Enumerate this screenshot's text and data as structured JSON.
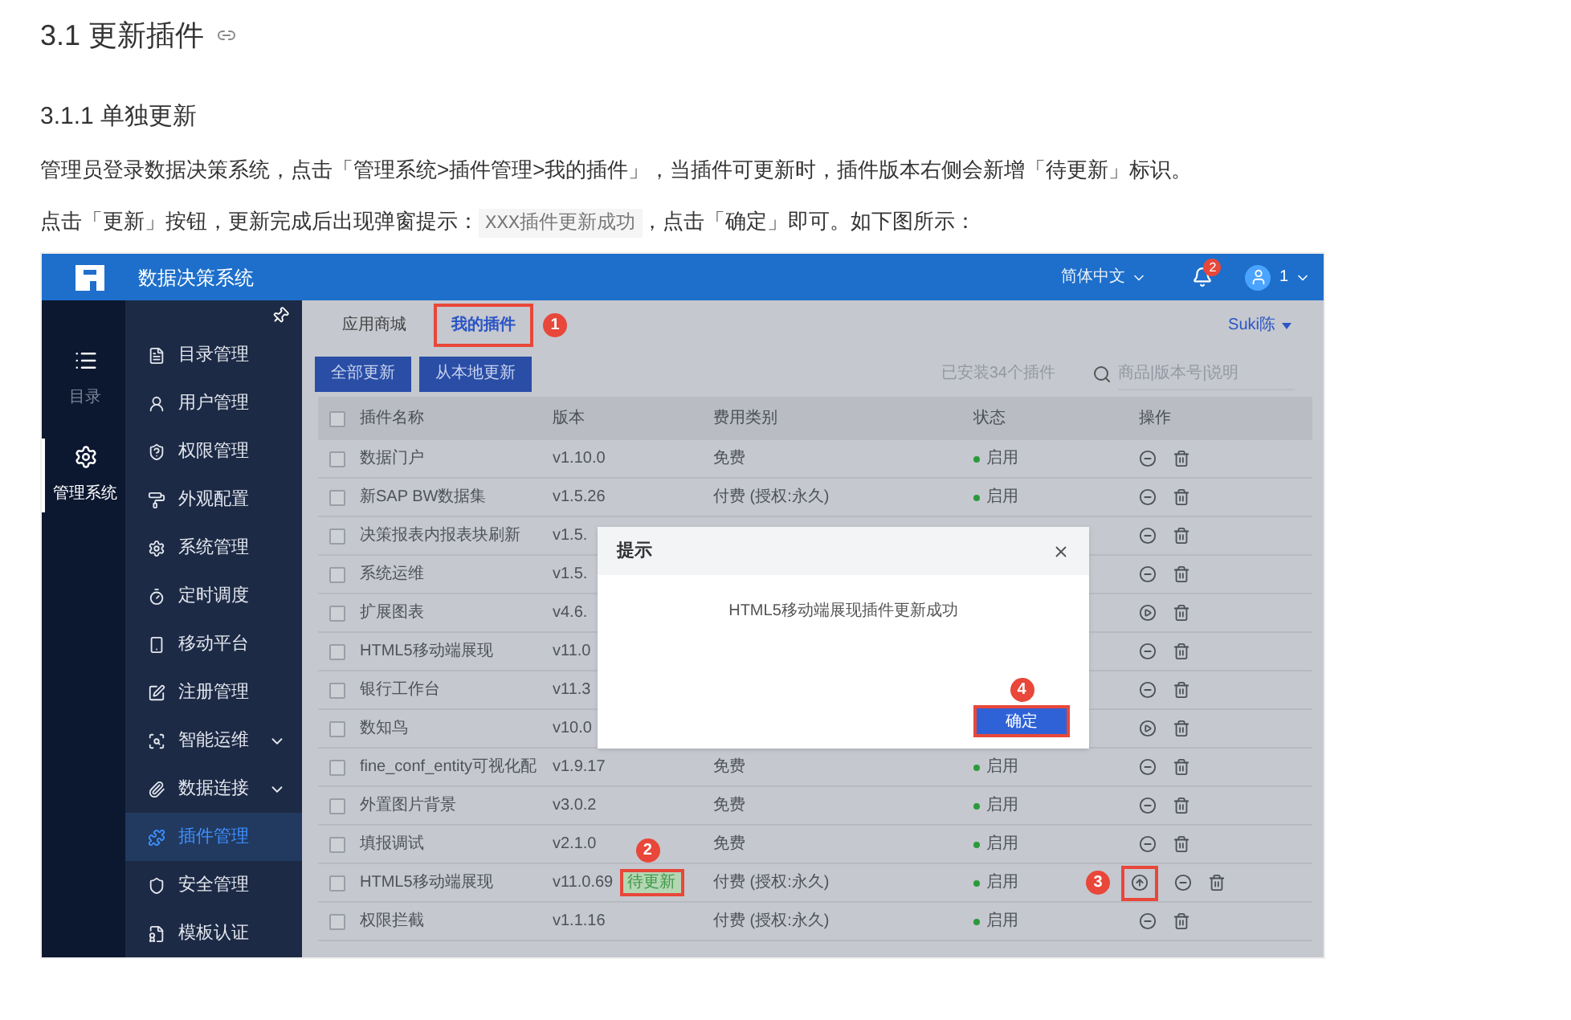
{
  "heading": "3.1 更新插件",
  "subheading": "3.1.1 单独更新",
  "paragraph_1": "管理员登录数据决策系统，点击「管理系统>插件管理>我的插件」，当插件可更新时，插件版本右侧会新增「待更新」标识。",
  "paragraph_2": {
    "before": "点击「更新」按钮，更新完成后出现弹窗提示：",
    "code": "XXX插件更新成功",
    "after": "，点击「确定」即可。如下图所示："
  },
  "app": {
    "title": "数据决策系统",
    "language": "简体中文",
    "notification_count": "2",
    "user": "1",
    "rail": [
      {
        "label": "目录",
        "selected": false
      },
      {
        "label": "管理系统",
        "selected": true
      }
    ],
    "menu": [
      {
        "label": "目录管理",
        "selected": false,
        "has_submenu": false
      },
      {
        "label": "用户管理",
        "selected": false,
        "has_submenu": false
      },
      {
        "label": "权限管理",
        "selected": false,
        "has_submenu": false
      },
      {
        "label": "外观配置",
        "selected": false,
        "has_submenu": false
      },
      {
        "label": "系统管理",
        "selected": false,
        "has_submenu": false
      },
      {
        "label": "定时调度",
        "selected": false,
        "has_submenu": false
      },
      {
        "label": "移动平台",
        "selected": false,
        "has_submenu": false
      },
      {
        "label": "注册管理",
        "selected": false,
        "has_submenu": false
      },
      {
        "label": "智能运维",
        "selected": false,
        "has_submenu": true
      },
      {
        "label": "数据连接",
        "selected": false,
        "has_submenu": true
      },
      {
        "label": "插件管理",
        "selected": true,
        "has_submenu": false
      },
      {
        "label": "安全管理",
        "selected": false,
        "has_submenu": false
      },
      {
        "label": "模板认证",
        "selected": false,
        "has_submenu": false
      }
    ],
    "tabs": [
      {
        "label": "应用商城",
        "selected": false
      },
      {
        "label": "我的插件",
        "selected": true,
        "callout": "1"
      }
    ],
    "account": "Suki陈",
    "buttons": [
      "全部更新",
      "从本地更新"
    ],
    "installed_count": "已安装34个插件",
    "search": {
      "placeholder": "商品|版本号|说明"
    },
    "select_all_checked": false,
    "columns": [
      "插件名称",
      "版本",
      "费用类别",
      "状态",
      "操作"
    ],
    "rows": [
      {
        "checked": false,
        "name": "数据门户",
        "version": "v1.10.0",
        "cost": "免费",
        "status": "启用",
        "enabled": true,
        "ops": [
          {
            "kind": "disable"
          },
          {
            "kind": "delete"
          }
        ]
      },
      {
        "checked": false,
        "name": "新SAP BW数据集",
        "version": "v1.5.26",
        "cost": "付费 (授权:永久)",
        "status": "启用",
        "enabled": true,
        "ops": [
          {
            "kind": "disable"
          },
          {
            "kind": "delete"
          }
        ]
      },
      {
        "checked": false,
        "name": "决策报表内报表块刷新",
        "version": "v1.5.",
        "ops": [
          {
            "kind": "disable"
          },
          {
            "kind": "delete"
          }
        ]
      },
      {
        "checked": false,
        "name": "系统运维",
        "version": "v1.5.",
        "ops": [
          {
            "kind": "disable"
          },
          {
            "kind": "delete"
          }
        ]
      },
      {
        "checked": false,
        "name": "扩展图表",
        "version": "v4.6.",
        "ops": [
          {
            "kind": "enable"
          },
          {
            "kind": "delete"
          }
        ]
      },
      {
        "checked": false,
        "name": "HTML5移动端展现",
        "version": "v11.0",
        "ops": [
          {
            "kind": "disable"
          },
          {
            "kind": "delete"
          }
        ]
      },
      {
        "checked": false,
        "name": "银行工作台",
        "version": "v11.3",
        "ops": [
          {
            "kind": "disable"
          },
          {
            "kind": "delete"
          }
        ]
      },
      {
        "checked": false,
        "name": "数知鸟",
        "version": "v10.0",
        "ops": [
          {
            "kind": "enable"
          },
          {
            "kind": "delete"
          }
        ]
      },
      {
        "checked": false,
        "name": "fine_conf_entity可视化配",
        "version": "v1.9.17",
        "cost": "免费",
        "status": "启用",
        "enabled": true,
        "ops": [
          {
            "kind": "disable"
          },
          {
            "kind": "delete"
          }
        ]
      },
      {
        "checked": false,
        "name": "外置图片背景",
        "version": "v3.0.2",
        "cost": "免费",
        "status": "启用",
        "enabled": true,
        "ops": [
          {
            "kind": "disable"
          },
          {
            "kind": "delete"
          }
        ]
      },
      {
        "checked": false,
        "name": "填报调试",
        "version": "v2.1.0",
        "cost": "免费",
        "status": "启用",
        "enabled": true,
        "ops": [
          {
            "kind": "disable"
          },
          {
            "kind": "delete"
          }
        ]
      },
      {
        "checked": false,
        "name": "HTML5移动端展现",
        "version": "v11.0.69",
        "tag": {
          "label": "待更新",
          "callout": "2"
        },
        "cost": "付费 (授权:永久)",
        "status": "启用",
        "enabled": true,
        "ops": [
          {
            "kind": "update",
            "callout": "3"
          },
          {
            "kind": "disable"
          },
          {
            "kind": "delete"
          }
        ]
      },
      {
        "checked": false,
        "name": "权限拦截",
        "version": "v1.1.16",
        "cost": "付费 (授权:永久)",
        "status": "启用",
        "enabled": true,
        "ops": [
          {
            "kind": "disable"
          },
          {
            "kind": "delete"
          }
        ]
      }
    ],
    "dialog": {
      "title": "提示",
      "message": "HTML5移动端展现插件更新成功",
      "button": "确定",
      "callout": "4"
    }
  }
}
